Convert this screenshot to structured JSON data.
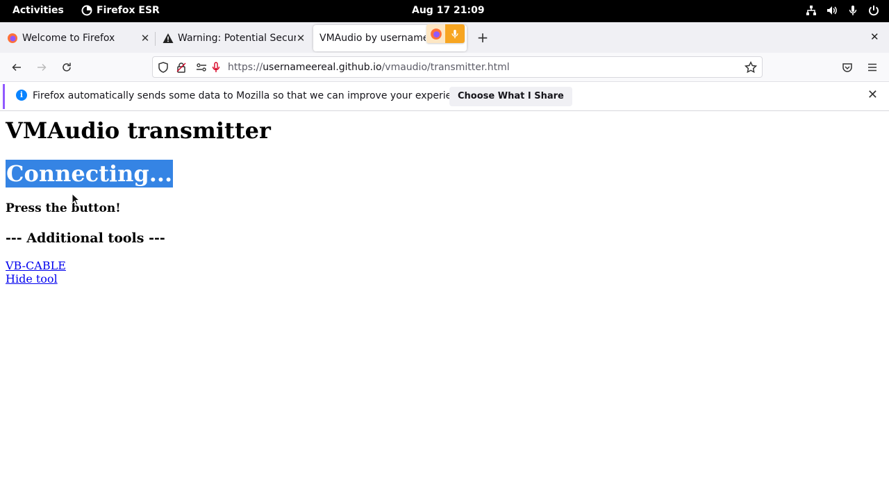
{
  "topbar": {
    "activities": "Activities",
    "app_name": "Firefox ESR",
    "clock": "Aug 17  21:09"
  },
  "tabs": [
    {
      "title": "Welcome to Firefox",
      "icon": "firefox-icon"
    },
    {
      "title": "Warning: Potential Securi",
      "icon": "warning-icon"
    },
    {
      "title": "VMAudio by usernamee",
      "icon": "none"
    }
  ],
  "urlbar": {
    "url_prefix": "https://",
    "url_host": "usernameereal.github.io",
    "url_path": "/vmaudio/transmitter.html"
  },
  "notification": {
    "message": "Firefox automatically sends some data to Mozilla so that we can improve your experience.",
    "button": "Choose What I Share"
  },
  "page": {
    "title": "VMAudio transmitter",
    "status": "Connecting...",
    "instruction": "Press the button!",
    "tools_heading": "--- Additional tools ---",
    "links": [
      "VB-CABLE",
      "Hide tool"
    ]
  },
  "colors": {
    "selection": "#3584e4",
    "link": "#0000ee",
    "sharing_indicator": "#f7a521"
  }
}
